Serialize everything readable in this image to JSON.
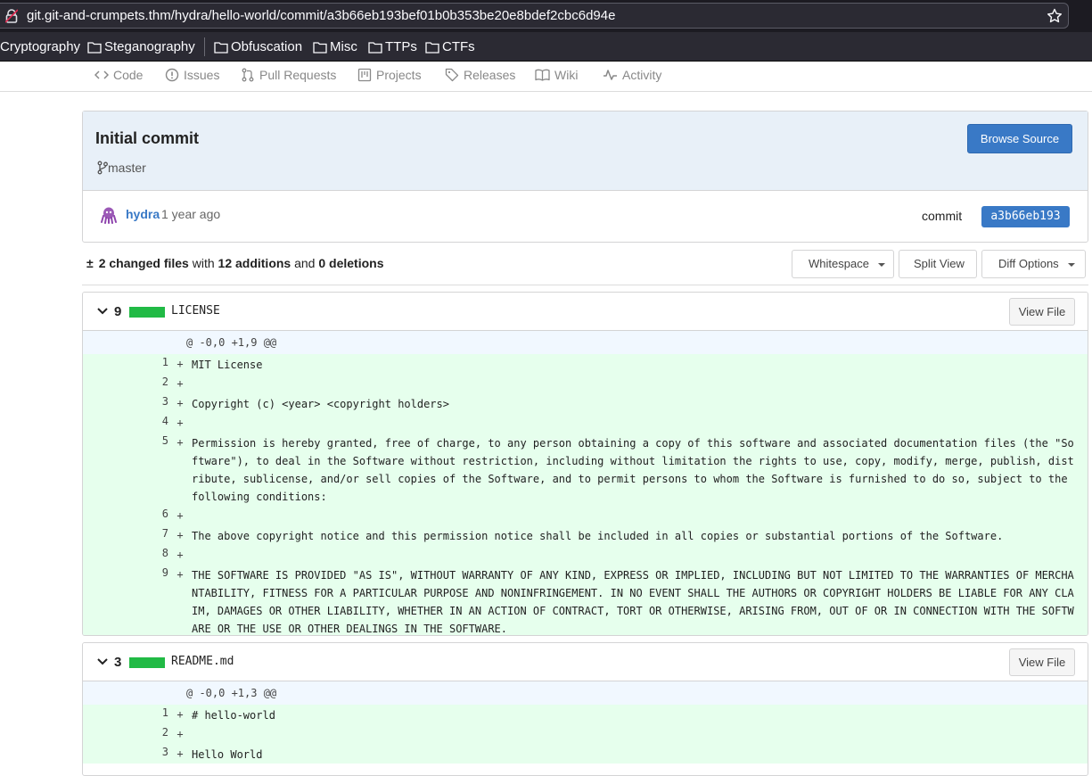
{
  "browser": {
    "url": "git.git-and-crumpets.thm/hydra/hello-world/commit/a3b66eb193bef01b0b353be20e8bdef2cbc6d94e",
    "bookmarks": [
      "Cryptography",
      "Steganography",
      "Obfuscation",
      "Misc",
      "TTPs",
      "CTFs"
    ]
  },
  "repo_nav": {
    "items": [
      {
        "label": "Code",
        "icon": "code-icon"
      },
      {
        "label": "Issues",
        "icon": "issue-icon"
      },
      {
        "label": "Pull Requests",
        "icon": "pull-request-icon"
      },
      {
        "label": "Projects",
        "icon": "project-icon"
      },
      {
        "label": "Releases",
        "icon": "tag-icon"
      },
      {
        "label": "Wiki",
        "icon": "book-icon"
      },
      {
        "label": "Activity",
        "icon": "pulse-icon"
      }
    ]
  },
  "commit": {
    "title": "Initial commit",
    "branch": "master",
    "browse_label": "Browse Source",
    "author": "hydra",
    "time": "1 year ago",
    "commit_label": "commit",
    "sha_short": "a3b66eb193"
  },
  "stats": {
    "changed": "2 changed files",
    "with": " with ",
    "additions": "12 additions",
    "and": " and ",
    "deletions": "0 deletions",
    "whitespace_label": "Whitespace",
    "split_label": "Split View",
    "diff_options_label": "Diff Options"
  },
  "files": [
    {
      "count": "9",
      "name": "LICENSE",
      "view_label": "View File",
      "hunk": "@ -0,0 +1,9 @@",
      "lines": [
        {
          "n": "1",
          "s": "+",
          "t": "MIT License"
        },
        {
          "n": "2",
          "s": "+",
          "t": ""
        },
        {
          "n": "3",
          "s": "+",
          "t": "Copyright (c) <year> <copyright holders>"
        },
        {
          "n": "4",
          "s": "+",
          "t": ""
        },
        {
          "n": "5",
          "s": "+",
          "t": "Permission is hereby granted, free of charge, to any person obtaining a copy of this software and associated documentation files (the \"Software\"), to deal in the Software without restriction, including without limitation the rights to use, copy, modify, merge, publish, distribute, sublicense, and/or sell copies of the Software, and to permit persons to whom the Software is furnished to do so, subject to the following conditions:"
        },
        {
          "n": "6",
          "s": "+",
          "t": ""
        },
        {
          "n": "7",
          "s": "+",
          "t": "The above copyright notice and this permission notice shall be included in all copies or substantial portions of the Software."
        },
        {
          "n": "8",
          "s": "+",
          "t": ""
        },
        {
          "n": "9",
          "s": "+",
          "t": "THE SOFTWARE IS PROVIDED \"AS IS\", WITHOUT WARRANTY OF ANY KIND, EXPRESS OR IMPLIED, INCLUDING BUT NOT LIMITED TO THE WARRANTIES OF MERCHANTABILITY, FITNESS FOR A PARTICULAR PURPOSE AND NONINFRINGEMENT. IN NO EVENT SHALL THE AUTHORS OR COPYRIGHT HOLDERS BE LIABLE FOR ANY CLAIM, DAMAGES OR OTHER LIABILITY, WHETHER IN AN ACTION OF CONTRACT, TORT OR OTHERWISE, ARISING FROM, OUT OF OR IN CONNECTION WITH THE SOFTWARE OR THE USE OR OTHER DEALINGS IN THE SOFTWARE."
        }
      ]
    },
    {
      "count": "3",
      "name": "README.md",
      "view_label": "View File",
      "hunk": "@ -0,0 +1,3 @@",
      "lines": [
        {
          "n": "1",
          "s": "+",
          "t": "# hello-world"
        },
        {
          "n": "2",
          "s": "+",
          "t": ""
        },
        {
          "n": "3",
          "s": "+",
          "t": "Hello World"
        }
      ]
    }
  ],
  "colors": {
    "accent": "#3979c6",
    "added_bg": "#e6ffed",
    "added_bar": "#21ba45"
  }
}
